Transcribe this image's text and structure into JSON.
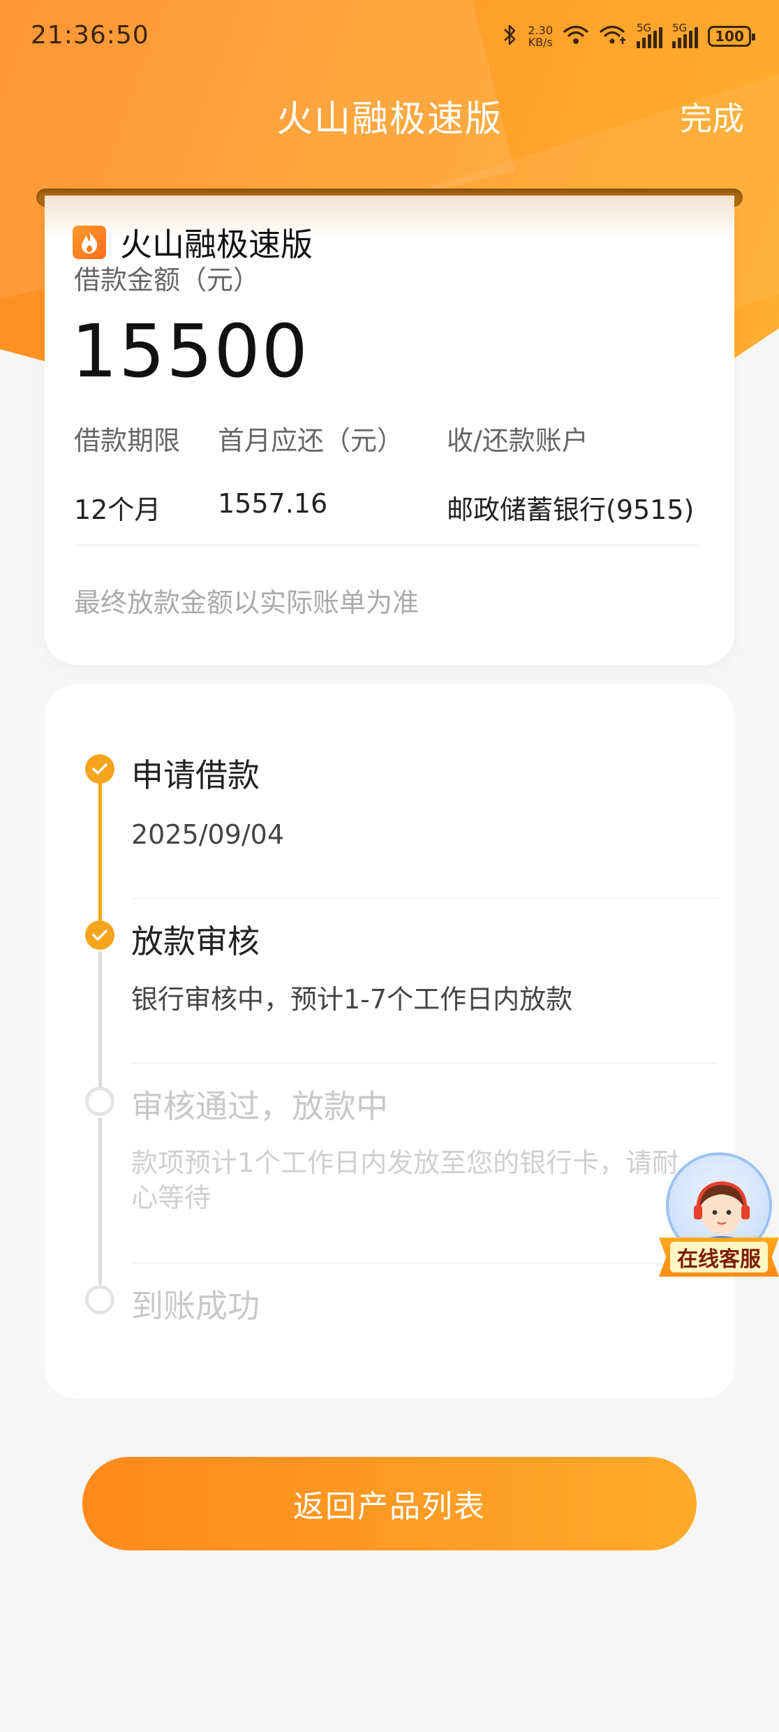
{
  "status_bar": {
    "time": "21:36:50",
    "net_speed_value": "2.30",
    "net_speed_unit": "KB/s",
    "sim1_label": "5G",
    "sim2_label": "5G",
    "battery": "100"
  },
  "nav": {
    "title": "火山融极速版",
    "done_label": "完成"
  },
  "loan": {
    "brand_name": "火山融极速版",
    "amount_label": "借款金额（元）",
    "amount": "15500",
    "term_label": "借款期限",
    "term_value": "12个月",
    "first_repay_label": "首月应还（元）",
    "first_repay_value": "1557.16",
    "account_label": "收/还款账户",
    "account_value": "邮政储蓄银行(9515)",
    "note": "最终放款金额以实际账单为准"
  },
  "progress": {
    "steps": [
      {
        "title": "申请借款",
        "desc": "2025/09/04",
        "status": "done"
      },
      {
        "title": "放款审核",
        "desc": "银行审核中，预计1-7个工作日内放款",
        "status": "done"
      },
      {
        "title": "审核通过，放款中",
        "desc": "款项预计1个工作日内发放至您的银行卡，请耐心等待",
        "status": "pending"
      },
      {
        "title": "到账成功",
        "desc": "",
        "status": "pending"
      }
    ]
  },
  "service_badge": {
    "label": "在线客服"
  },
  "main_button": {
    "label": "返回产品列表"
  },
  "colors": {
    "brand_orange": "#ff9a24",
    "step_done": "#f6a41c",
    "step_pending": "#e4e4e4"
  },
  "icons": {
    "bluetooth": "bluetooth-icon",
    "wifi": "wifi-icon",
    "hotspot": "wifi-hotspot-icon",
    "check": "check-icon",
    "brand": "flame-icon"
  }
}
